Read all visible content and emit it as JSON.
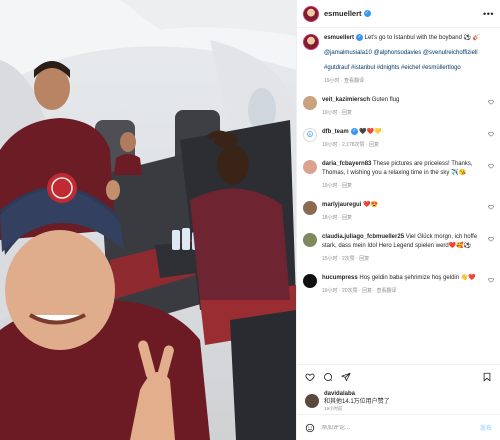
{
  "post": {
    "username": "esmuellert",
    "caption_text": "Let's go to Istanbul with the boyband ⚽ 🎸",
    "mentions": "@jamalmusiala10 @alphonsodavies @svenulreichoffiziell",
    "tags": "#gutdrauf #istanbul #dnights #eichel #esmüllertlogo",
    "caption_meta": "19小时 · 查看翻译"
  },
  "comments": [
    {
      "username": "veit_kazimiersch",
      "text": "Guten flug",
      "meta": "19小时 · 回复",
      "avatar_color": "#c9a27e"
    },
    {
      "username": "dfb_team",
      "text": "🖤❤️💛",
      "meta": "19小时 · 2,178次赞 · 回复",
      "avatar_color": "#ffffff"
    },
    {
      "username": "daria_fcbayern83",
      "text": "These pictures are priceless! Thanks, Thomas, I wishing you a relaxing time in the sky ✈️😘",
      "meta": "19小时 · 回复",
      "avatar_color": "#d9a38f"
    },
    {
      "username": "marlyjauregui",
      "text": "❤️😍",
      "meta": "18小时 · 回复",
      "avatar_color": "#8c6a4f"
    },
    {
      "username": "claudia.juliago_fcbmueller25",
      "text": "Viel Glück morgn, ich hoffe stark, dass mein Idol Hero Legend spielen werd❤️🥰⚽",
      "meta": "15小时 · 2次赞 · 回复",
      "avatar_color": "#7d8a5e"
    },
    {
      "username": "hucumpress",
      "text": "Hoş geldin baba şehrimize hoş geldin 👋❤️",
      "meta": "19小时 · 20次赞 · 回复 · 查看翻译",
      "avatar_color": "#111111"
    }
  ],
  "likes": {
    "liker": "davidalaba",
    "text": "和其他14.1万位用户赞了",
    "time": "19小时前"
  },
  "add_comment": {
    "placeholder": "添加评论...",
    "post_label": "发布"
  }
}
